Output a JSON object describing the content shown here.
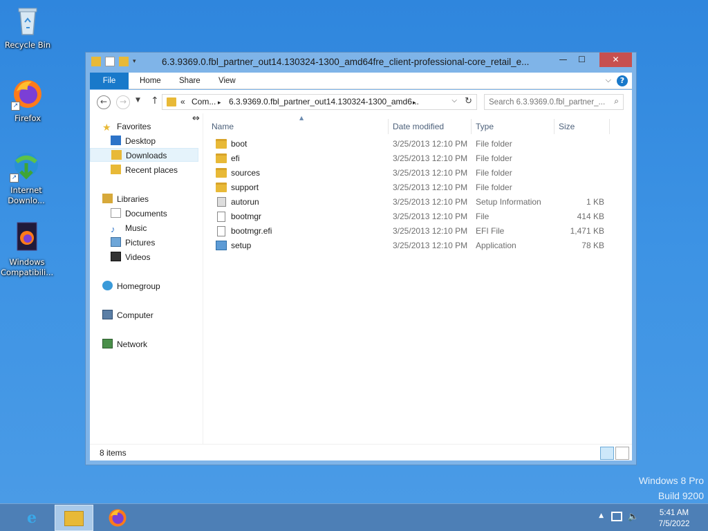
{
  "desktop": {
    "icons": [
      {
        "label": "Recycle Bin",
        "icon": "recycle-bin-icon"
      },
      {
        "label": "Firefox",
        "icon": "firefox-icon"
      },
      {
        "label": "Internet Downlo...",
        "icon": "internet-download-manager-icon"
      },
      {
        "label": "Windows Compatibili...",
        "icon": "windows-compatibility-icon"
      }
    ],
    "watermark": {
      "line1": "Windows 8 Pro",
      "line2": "Build 9200"
    }
  },
  "window": {
    "title": "6.3.9369.0.fbl_partner_out14.130324-1300_amd64fre_client-professional-core_retail_e...",
    "ribbon_tabs": {
      "file": "File",
      "home": "Home",
      "share": "Share",
      "view": "View"
    },
    "address": {
      "prefix": "«",
      "segment1": "Com...",
      "segment2": "6.3.9369.0.fbl_partner_out14.130324-1300_amd6..."
    },
    "search_placeholder": "Search 6.3.9369.0.fbl_partner_...",
    "nav_pane": {
      "favorites": "Favorites",
      "desktop": "Desktop",
      "downloads": "Downloads",
      "recent": "Recent places",
      "libraries": "Libraries",
      "documents": "Documents",
      "music": "Music",
      "pictures": "Pictures",
      "videos": "Videos",
      "homegroup": "Homegroup",
      "computer": "Computer",
      "network": "Network"
    },
    "columns": {
      "name": "Name",
      "date": "Date modified",
      "type": "Type",
      "size": "Size"
    },
    "files": [
      {
        "name": "boot",
        "date": "3/25/2013 12:10 PM",
        "type": "File folder",
        "size": "",
        "kind": "folder"
      },
      {
        "name": "efi",
        "date": "3/25/2013 12:10 PM",
        "type": "File folder",
        "size": "",
        "kind": "folder"
      },
      {
        "name": "sources",
        "date": "3/25/2013 12:10 PM",
        "type": "File folder",
        "size": "",
        "kind": "folder"
      },
      {
        "name": "support",
        "date": "3/25/2013 12:10 PM",
        "type": "File folder",
        "size": "",
        "kind": "folder"
      },
      {
        "name": "autorun",
        "date": "3/25/2013 12:10 PM",
        "type": "Setup Information",
        "size": "1 KB",
        "kind": "setupinfo"
      },
      {
        "name": "bootmgr",
        "date": "3/25/2013 12:10 PM",
        "type": "File",
        "size": "414 KB",
        "kind": "file"
      },
      {
        "name": "bootmgr.efi",
        "date": "3/25/2013 12:10 PM",
        "type": "EFI File",
        "size": "1,471 KB",
        "kind": "file"
      },
      {
        "name": "setup",
        "date": "3/25/2013 12:10 PM",
        "type": "Application",
        "size": "78 KB",
        "kind": "app"
      }
    ],
    "status": {
      "count": "8 items"
    }
  },
  "taskbar": {
    "clock_time": "5:41 AM",
    "clock_date": "7/5/2022"
  }
}
